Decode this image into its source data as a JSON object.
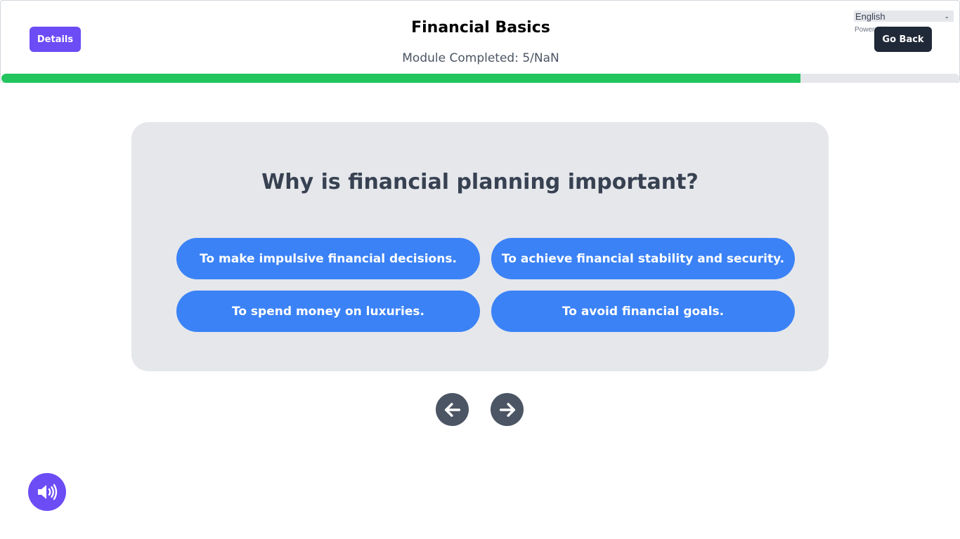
{
  "header": {
    "details_label": "Details",
    "title": "Financial Basics",
    "subtitle": "Module Completed: 5/NaN",
    "language": "English",
    "powered_by": "Powered by",
    "go_back_label": "Go Back",
    "progress_fraction": 0.834
  },
  "quiz": {
    "question": "Why is financial planning important?",
    "options": [
      "To make impulsive financial decisions.",
      "To achieve financial stability and security.",
      "To spend money on luxuries.",
      "To avoid financial goals."
    ]
  },
  "navigation": {
    "prev_icon": "arrow-left-icon",
    "next_icon": "arrow-right-icon"
  },
  "audio": {
    "icon": "speaker-icon"
  },
  "colors": {
    "primary_purple": "#6c4cf5",
    "option_blue": "#3b82f6",
    "progress_green": "#22c55e",
    "dark_button": "#1f2937"
  }
}
